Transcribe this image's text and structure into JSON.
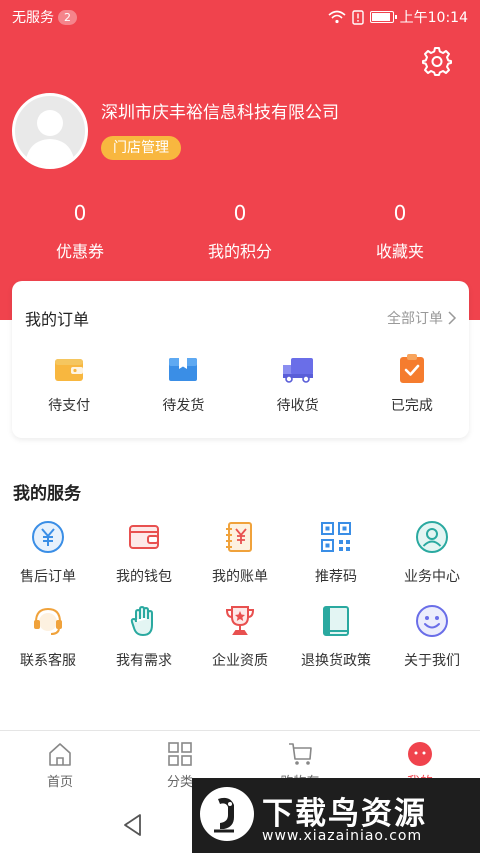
{
  "status_bar": {
    "carrier": "无服务",
    "sim_badge": "2",
    "time": "上午10:14",
    "battery_level": 0.85
  },
  "profile": {
    "company_name": "深圳市庆丰裕信息科技有限公司",
    "store_button": "门店管理"
  },
  "stats": [
    {
      "value": "0",
      "label": "优惠券"
    },
    {
      "value": "0",
      "label": "我的积分"
    },
    {
      "value": "0",
      "label": "收藏夹"
    }
  ],
  "orders": {
    "title": "我的订单",
    "all_link": "全部订单",
    "items": [
      {
        "label": "待支付",
        "icon": "wallet-icon"
      },
      {
        "label": "待发货",
        "icon": "package-icon"
      },
      {
        "label": "待收货",
        "icon": "truck-icon"
      },
      {
        "label": "已完成",
        "icon": "clipboard-check-icon"
      }
    ]
  },
  "services": {
    "title": "我的服务",
    "items": [
      {
        "label": "售后订单",
        "icon": "yen-circle-icon"
      },
      {
        "label": "我的钱包",
        "icon": "wallet-icon"
      },
      {
        "label": "我的账单",
        "icon": "bill-icon"
      },
      {
        "label": "推荐码",
        "icon": "qr-code-icon"
      },
      {
        "label": "业务中心",
        "icon": "user-circle-icon"
      },
      {
        "label": "联系客服",
        "icon": "headset-icon"
      },
      {
        "label": "我有需求",
        "icon": "hand-icon"
      },
      {
        "label": "企业资质",
        "icon": "trophy-icon"
      },
      {
        "label": "退换货政策",
        "icon": "book-icon"
      },
      {
        "label": "关于我们",
        "icon": "smile-icon"
      }
    ]
  },
  "tabbar": [
    {
      "label": "首页",
      "icon": "home-icon",
      "active": false
    },
    {
      "label": "分类",
      "icon": "grid-icon",
      "active": false
    },
    {
      "label": "购物车",
      "icon": "cart-icon",
      "active": false
    },
    {
      "label": "我的",
      "icon": "profile-icon",
      "active": true
    }
  ],
  "watermark": {
    "title": "下载鸟资源",
    "url": "www.xiazainiao.com"
  },
  "colors": {
    "brand_red": "#f0434d",
    "store_button": "#f8b73f",
    "icon_blue": "#3a8ee6",
    "icon_red": "#e8504f",
    "icon_orange": "#f0a23b",
    "icon_teal": "#2aa9a0",
    "icon_purple": "#6a6ee8"
  }
}
